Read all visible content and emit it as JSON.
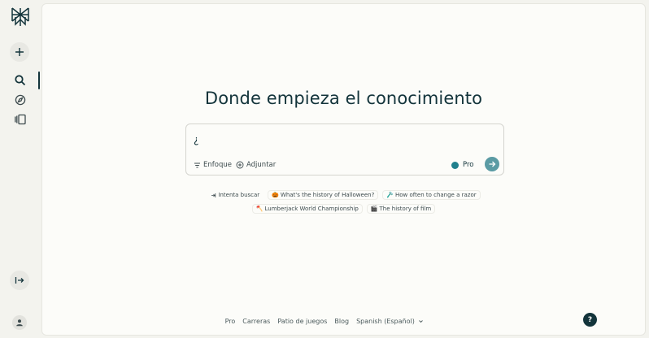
{
  "sidebar": {
    "logo_icon": "perplexity-logo-icon",
    "new_thread_icon": "plus-icon",
    "nav": [
      {
        "name": "search",
        "icon": "search-icon",
        "active": true
      },
      {
        "name": "discover",
        "icon": "compass-icon",
        "active": false
      },
      {
        "name": "library",
        "icon": "library-icon",
        "active": false
      }
    ],
    "expand_icon": "expand-sidebar-icon",
    "account_icon": "user-icon"
  },
  "main": {
    "headline": "Donde empieza el conocimiento",
    "search": {
      "value": "¿",
      "focus_label": "Enfoque",
      "attach_label": "Adjuntar",
      "pro_label": "Pro",
      "pro_enabled": true
    },
    "suggestions_label": "Intenta buscar",
    "suggestions": [
      {
        "emoji": "🎃",
        "text": "What's the history of Halloween?"
      },
      {
        "emoji": "🪒",
        "text": "How often to change a razor"
      },
      {
        "emoji": "🪓",
        "text": "Lumberjack World Championship"
      },
      {
        "emoji": "🎬",
        "text": "The history of film"
      }
    ]
  },
  "footer": {
    "links": [
      "Pro",
      "Carreras",
      "Patio de juegos",
      "Blog"
    ],
    "language": "Spanish (Español)"
  },
  "help_label": "?",
  "colors": {
    "accent": "#20808d",
    "text": "#13343b",
    "background": "#fcfcf9",
    "sidebar": "#f3f3ee"
  }
}
